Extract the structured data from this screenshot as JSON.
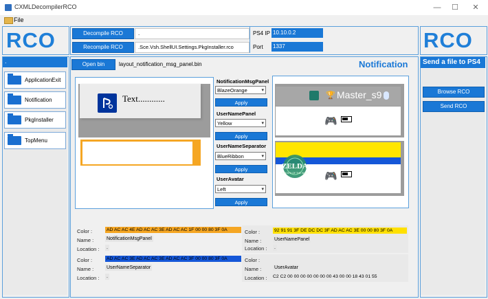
{
  "window": {
    "title": "CXMLDecompilerRCO",
    "minimize": "—",
    "maximize": "☐",
    "close": "✕"
  },
  "menu": {
    "file": "File"
  },
  "logo": "RCO",
  "toolbar": {
    "decompile_label": "Decompile RCO",
    "decompile_value": ".",
    "recompile_label": "Recompile RCO",
    "recompile_value": ".Sce.Vsh.ShellUI.Settings.PkgInstaller.rco",
    "ps4ip_label": "PS4 IP",
    "ps4ip_value": "10.10.0.2",
    "port_label": "Port",
    "port_value": "1337"
  },
  "sidebar": {
    "header": ".",
    "items": [
      {
        "label": "ApplicationExit"
      },
      {
        "label": "Notification"
      },
      {
        "label": "PkgInstaller"
      },
      {
        "label": "TopMenu"
      }
    ]
  },
  "main": {
    "open_bin_label": "Open bin",
    "file_name": "layout_notification_msg_panel.bin",
    "section_title": "Notification",
    "preview_text": "Text............",
    "controls": [
      {
        "label": "NotificationMsgPanel",
        "value": "BlazeOrange",
        "apply": "Apply"
      },
      {
        "label": "UserNamePanel",
        "value": "Yellow",
        "apply": "Apply"
      },
      {
        "label": "UserNameSeparator",
        "value": "BlueRibbon",
        "apply": "Apply"
      },
      {
        "label": "UserAvatar",
        "value": "Left",
        "apply": "Apply"
      }
    ],
    "right_preview": {
      "user_name": "Master_s9",
      "logo_text": "ZELDA",
      "logo_sub": "BREATH OF THE WILD"
    }
  },
  "info": {
    "color_label": "Color :",
    "name_label": "Name :",
    "location_label": "Location :",
    "blocks": [
      {
        "hex": "AD AC AC 4E AD AC AC 3E AD AC AC 1F 00 00 80 3F 0A",
        "name": "NotificationMsgPanel",
        "location": ".",
        "hex_bg": "#f5a623"
      },
      {
        "hex": "92 91 91 3F DE DC DC 3F AD AC AC 3E 00 00 80 3F 0A",
        "name": "UserNamePanel",
        "location": ".",
        "hex_bg": "#ffe000"
      },
      {
        "hex": "AD AC AC 3E AD AC AC 3E AD AC AC 3F 00 00 80 3F 0A",
        "name": "UserNameSeparator",
        "location": ".",
        "hex_bg": "#1557d8"
      },
      {
        "hex": "",
        "name": "UserAvatar",
        "location": "C2 C2 00 00 00 00 00 00 00 43 00 00 18 43 01 55",
        "hex_bg": "#f0f0f0"
      }
    ]
  },
  "right_panel": {
    "title": "Send a file to PS4",
    "browse_label": "Browse RCO",
    "send_label": "Send RCO"
  }
}
